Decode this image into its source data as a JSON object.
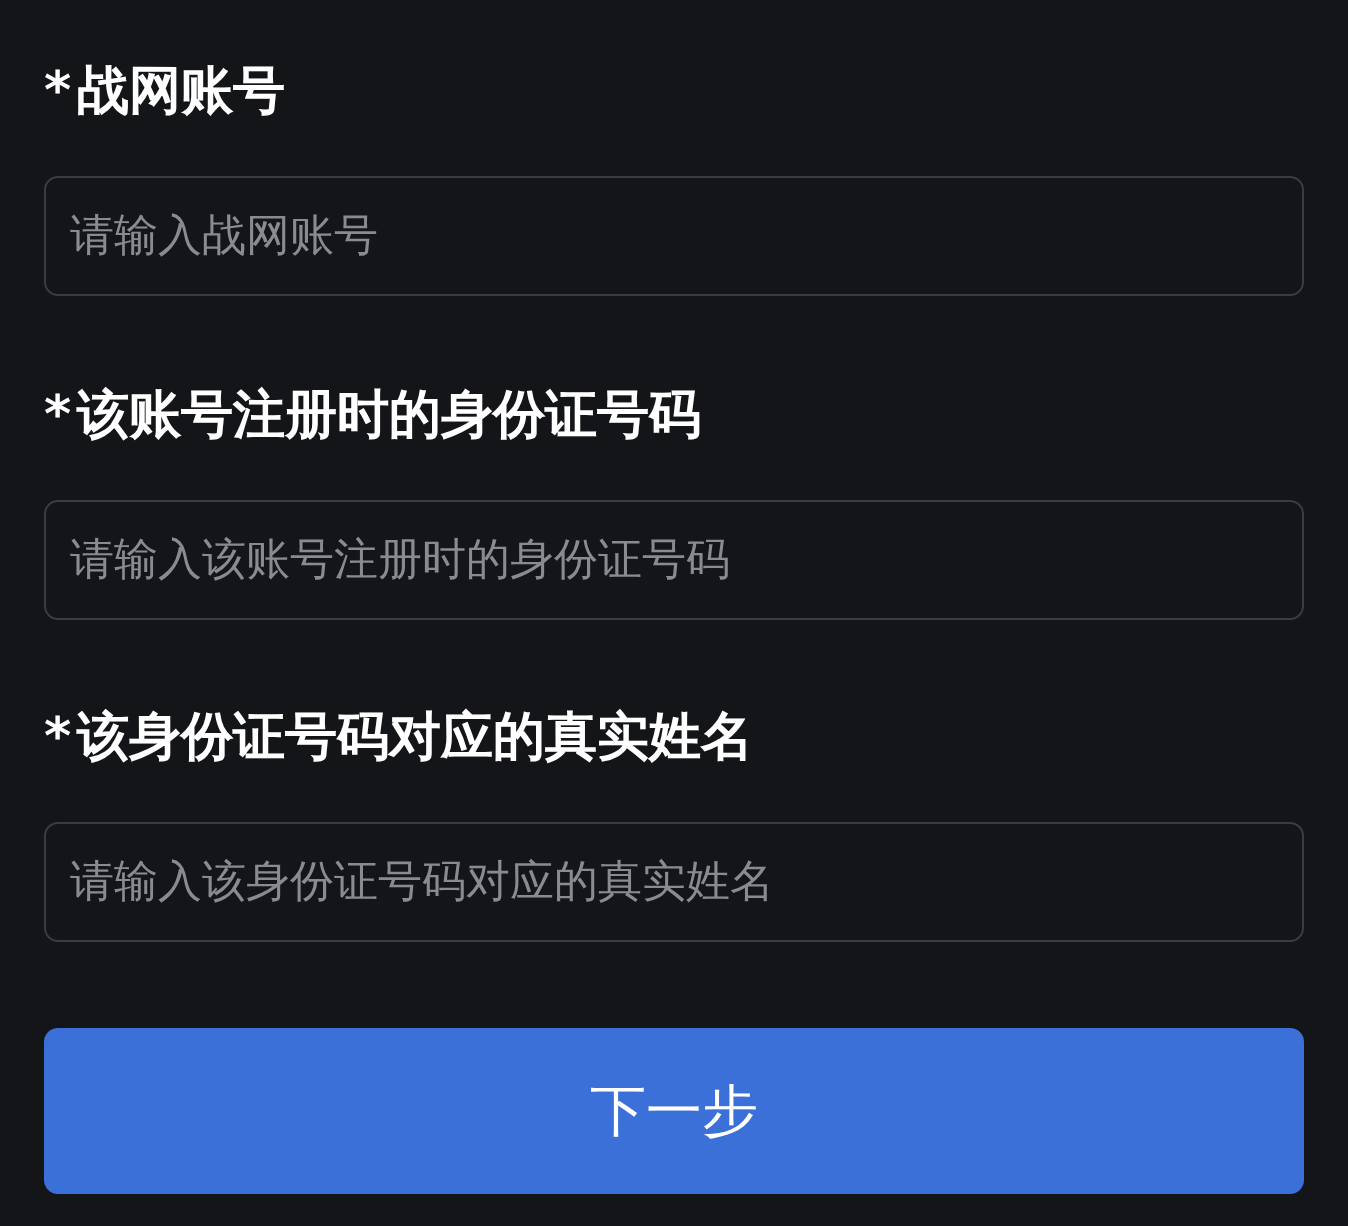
{
  "fields": [
    {
      "marker": "*",
      "label": "战网账号",
      "placeholder": "请输入战网账号"
    },
    {
      "marker": "*",
      "label": "该账号注册时的身份证号码",
      "placeholder": "请输入该账号注册时的身份证号码"
    },
    {
      "marker": "*",
      "label": "该身份证号码对应的真实姓名",
      "placeholder": "请输入该身份证号码对应的真实姓名"
    }
  ],
  "button": "下一步"
}
